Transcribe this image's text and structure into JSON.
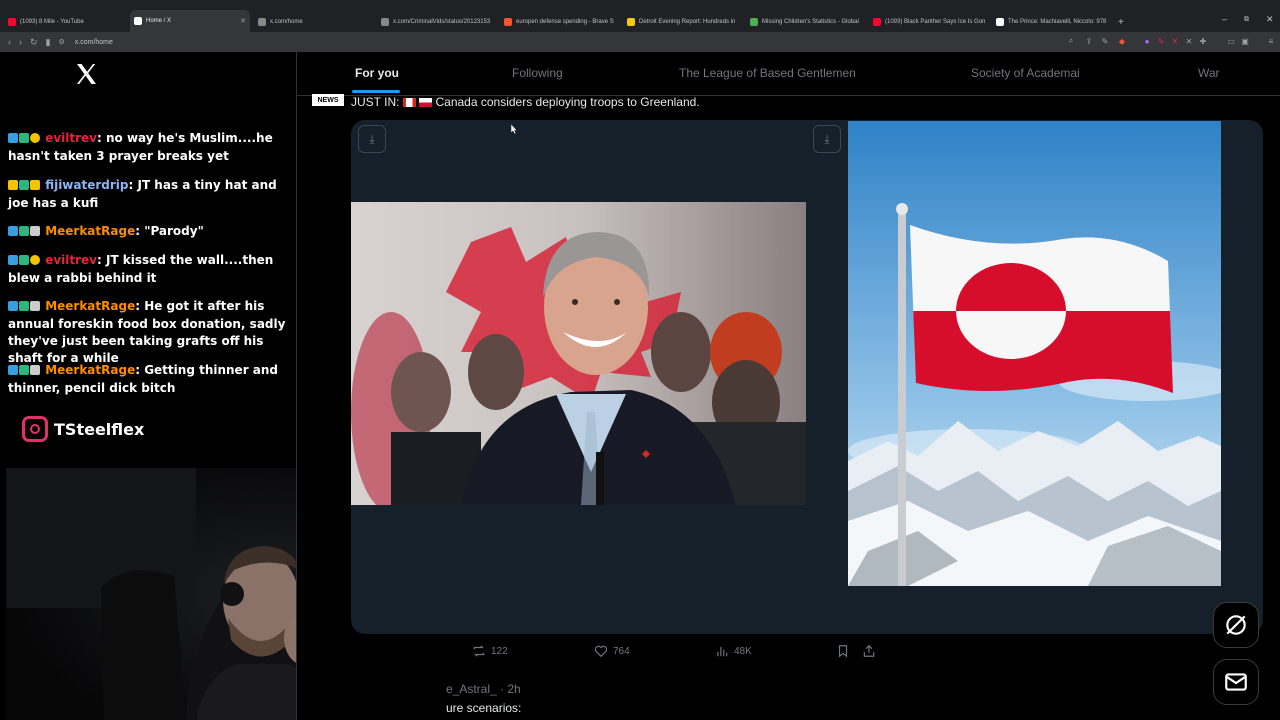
{
  "browser": {
    "tabs": [
      {
        "label": "(1093) 8 Mile - YouTube",
        "fav": "#ff0033"
      },
      {
        "label": "Home / X",
        "fav": "#000000"
      },
      {
        "label": "x.com/home",
        "fav": "#000000"
      },
      {
        "label": "x.com/CriminalVids/status/20123153",
        "fav": "#000000"
      },
      {
        "label": "europen defense spending - Brave S",
        "fav": "#fb542b"
      },
      {
        "label": "Detroit Evening Report: Hundreds in",
        "fav": "#f6c90e"
      },
      {
        "label": "Missing Children's Statistics - Global",
        "fav": "#4caf50"
      },
      {
        "label": "(1093) Black Panther Says Ice Is Gon",
        "fav": "#ff0033"
      },
      {
        "label": "The Prince: Machiavelli, Niccolo: 978",
        "fav": "#ffffff"
      }
    ],
    "new_tab": "+",
    "url": "x.com/home",
    "window_controls": [
      "–",
      "⧉",
      "✕"
    ]
  },
  "chat": {
    "messages": [
      {
        "user": "eviltrev",
        "color": "#e5243b",
        "text": ": no way he's Muslim....he hasn't taken 3 prayer breaks yet"
      },
      {
        "user": "fijiwaterdrip",
        "color": "#8ab4f8",
        "text": ": JT has a tiny hat and joe has a kufi"
      },
      {
        "user": "MeerkatRage",
        "color": "#ff8c00",
        "text": ": \"Parody\""
      },
      {
        "user": "eviltrev",
        "color": "#e5243b",
        "text": ": JT kissed the wall....then blew a rabbi behind it"
      },
      {
        "user": "MeerkatRage",
        "color": "#ff8c00",
        "text": ": He got it after his annual foreskin food box donation, sadly they've just been taking grafts off his shaft for a while"
      },
      {
        "user": "MeerkatRage",
        "color": "#ff8c00",
        "text": ": Getting thinner and thinner, pencil dick bitch"
      }
    ],
    "instagram_handle": "TSteelflex"
  },
  "feed": {
    "tabs": [
      "For you",
      "Following",
      "The League of Based Gentlemen",
      "Society of Academai",
      "War"
    ],
    "active_tab": "For you",
    "accent": "#1d9bf0"
  },
  "post": {
    "tag": "NEWS",
    "prefix": "JUST IN:",
    "headline": "Canada considers deploying troops to Greenland.",
    "retweets": "122",
    "likes": "764",
    "views": "48K"
  },
  "next_post": {
    "author": "e_Astral_ · 2h",
    "text": "ure scenarios:"
  },
  "icons": {
    "fab_top": "grok-icon",
    "fab_bottom": "messages-icon"
  }
}
